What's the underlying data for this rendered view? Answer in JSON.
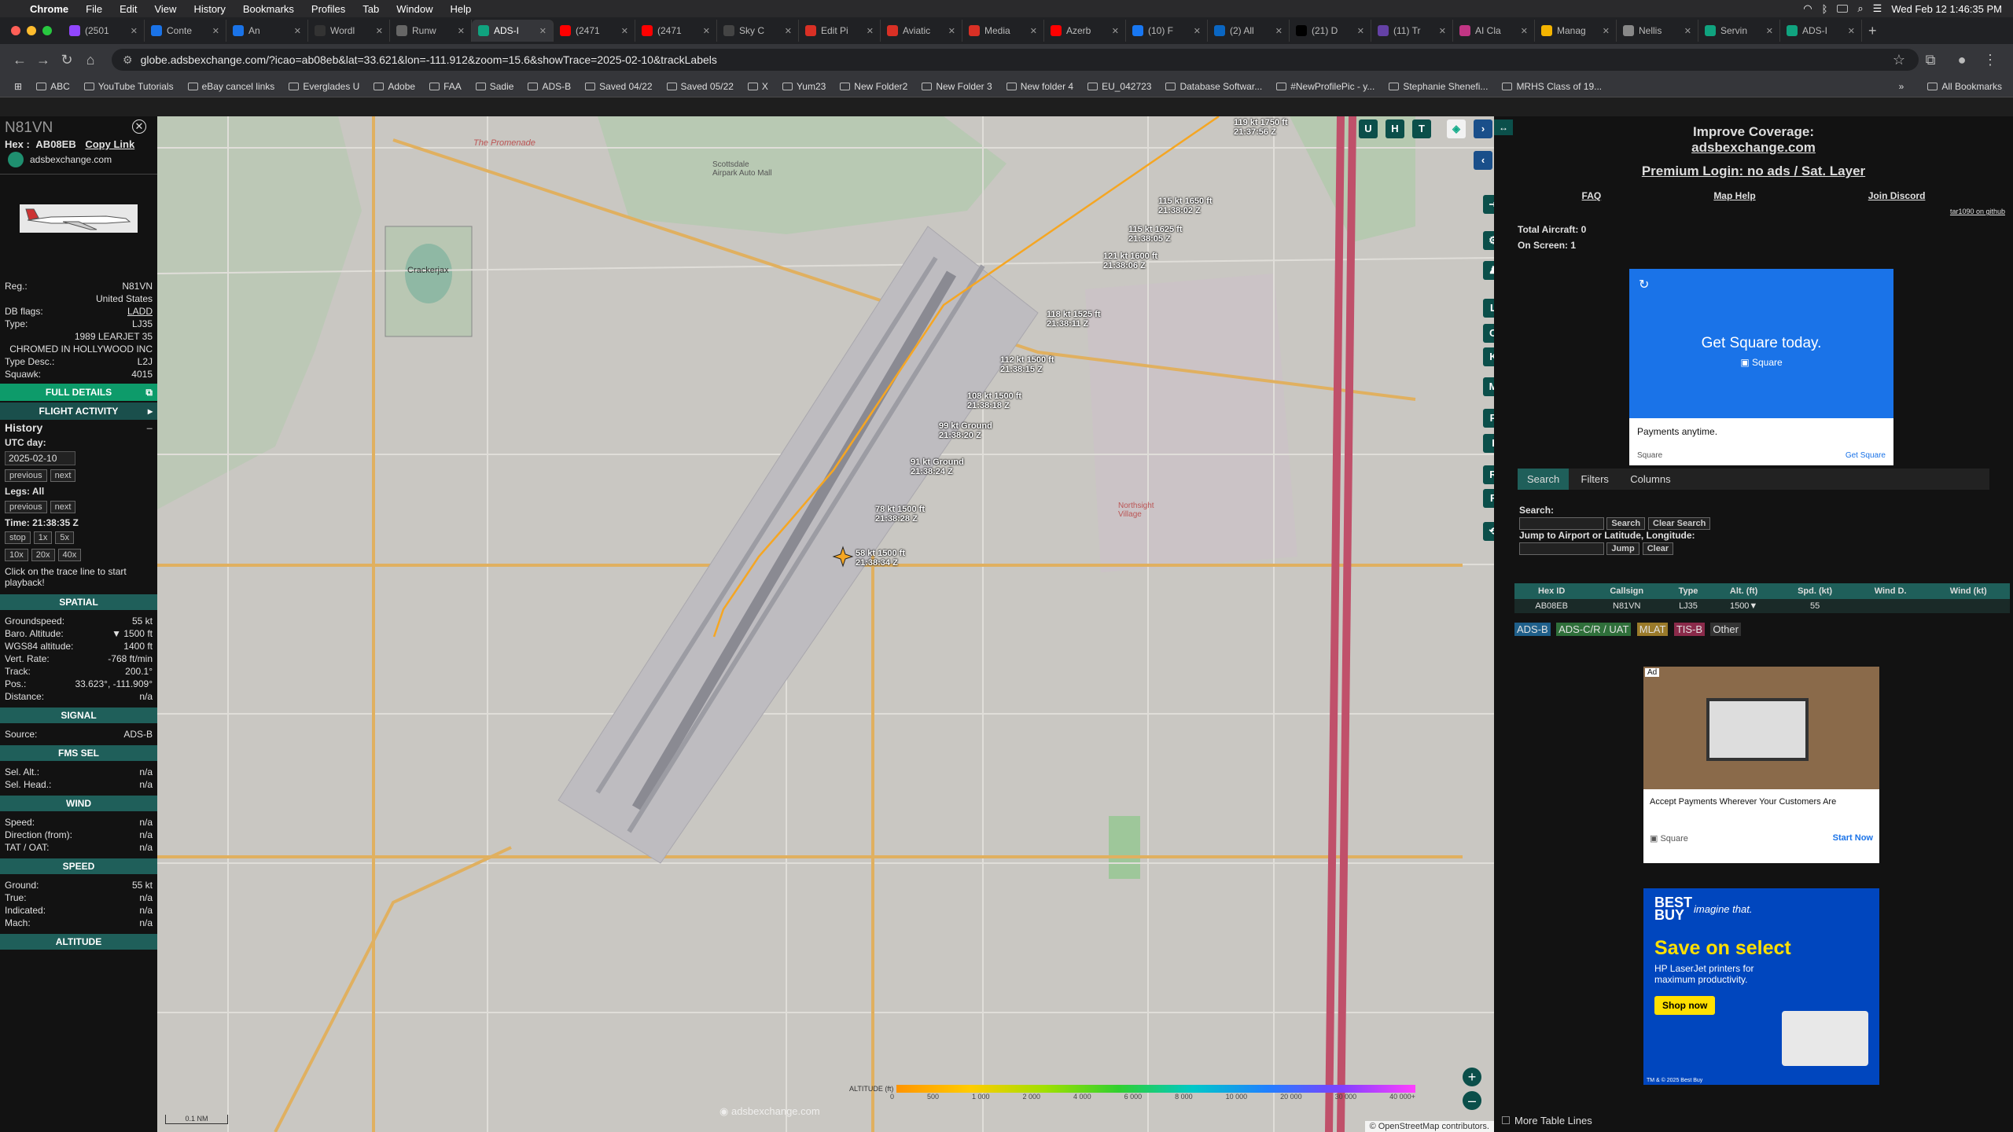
{
  "menubar": {
    "apple": "",
    "app": "Chrome",
    "items": [
      "File",
      "Edit",
      "View",
      "History",
      "Bookmarks",
      "Profiles",
      "Tab",
      "Window",
      "Help"
    ],
    "clock": "Wed Feb 12  1:46:35 PM"
  },
  "tabs": [
    {
      "label": "(2501",
      "color": "#9146ff"
    },
    {
      "label": "Conte",
      "color": "#1a73e8"
    },
    {
      "label": "An",
      "color": "#1a73e8"
    },
    {
      "label": "Wordl",
      "color": "#333"
    },
    {
      "label": "Runw",
      "color": "#666"
    },
    {
      "label": "ADS-I",
      "color": "#10a37f",
      "active": true
    },
    {
      "label": "(2471",
      "color": "#ff0000"
    },
    {
      "label": "(2471",
      "color": "#ff0000"
    },
    {
      "label": "Sky C",
      "color": "#444"
    },
    {
      "label": "Edit Pi",
      "color": "#d93025"
    },
    {
      "label": "Aviatic",
      "color": "#d93025"
    },
    {
      "label": "Media",
      "color": "#d93025"
    },
    {
      "label": "Azerb",
      "color": "#ff0000"
    },
    {
      "label": "(10) F",
      "color": "#1877f2"
    },
    {
      "label": "(2) All",
      "color": "#0a66c2"
    },
    {
      "label": "(21) D",
      "color": "#000"
    },
    {
      "label": "(11) Tr",
      "color": "#6441a5"
    },
    {
      "label": "AI Cla",
      "color": "#c13584"
    },
    {
      "label": "Manag",
      "color": "#f4b400"
    },
    {
      "label": "Nellis",
      "color": "#888"
    },
    {
      "label": "Servin",
      "color": "#10a37f"
    },
    {
      "label": "ADS-I",
      "color": "#10a37f"
    }
  ],
  "address": {
    "url": "globe.adsbexchange.com/?icao=ab08eb&lat=33.621&lon=-111.912&zoom=15.6&showTrace=2025-02-10&trackLabels"
  },
  "bookmarks": [
    "ABC",
    "YouTube Tutorials",
    "eBay cancel links",
    "Everglades U",
    "Adobe",
    "FAA",
    "Sadie",
    "ADS-B",
    "Saved 04/22",
    "Saved 05/22",
    "X",
    "Yum23",
    "New Folder2",
    "New Folder 3",
    "New folder 4",
    "EU_042723",
    "Database Softwar...",
    "#NewProfilePic - y...",
    "Stephanie Shenefi...",
    "MRHS Class of 19..."
  ],
  "bookmarks_all": "All Bookmarks",
  "aircraft": {
    "reg_title": "N81VN",
    "hex_label": "Hex :",
    "hex": "AB08EB",
    "copy_link": "Copy Link",
    "site": "adsbexchange.com",
    "reg_label": "Reg.:",
    "reg": "N81VN",
    "country": "United States",
    "dbflags_label": "DB flags:",
    "dbflags": "LADD",
    "type_label": "Type:",
    "type": "LJ35",
    "model": "1989 LEARJET 35",
    "owner": "CHROMED IN HOLLYWOOD INC",
    "typedesc_label": "Type Desc.:",
    "typedesc": "L2J",
    "squawk_label": "Squawk:",
    "squawk": "4015",
    "full_details": "FULL DETAILS",
    "flight_activity": "FLIGHT ACTIVITY"
  },
  "history": {
    "title": "History",
    "utc_label": "UTC day:",
    "utc_day": "2025-02-10",
    "prev": "previous",
    "next": "next",
    "legs": "Legs: All",
    "time": "Time: 21:38:35 Z",
    "speeds": [
      "stop",
      "1x",
      "5x"
    ],
    "speeds2": [
      "10x",
      "20x",
      "40x"
    ],
    "hint": "Click on the trace line to start playback!"
  },
  "spatial": {
    "title": "SPATIAL",
    "rows": [
      {
        "k": "Groundspeed:",
        "v": "55 kt"
      },
      {
        "k": "Baro. Altitude:",
        "v": "▼ 1500 ft"
      },
      {
        "k": "WGS84 altitude:",
        "v": "1400 ft"
      },
      {
        "k": "Vert. Rate:",
        "v": "-768 ft/min"
      },
      {
        "k": "Track:",
        "v": "200.1°"
      },
      {
        "k": "Pos.:",
        "v": "33.623°, -111.909°"
      },
      {
        "k": "Distance:",
        "v": "n/a"
      }
    ]
  },
  "signal": {
    "title": "SIGNAL",
    "rows": [
      {
        "k": "Source:",
        "v": "ADS-B"
      }
    ]
  },
  "fmssel": {
    "title": "FMS SEL",
    "rows": [
      {
        "k": "Sel. Alt.:",
        "v": "n/a"
      },
      {
        "k": "Sel. Head.:",
        "v": "n/a"
      }
    ]
  },
  "wind": {
    "title": "WIND",
    "rows": [
      {
        "k": "Speed:",
        "v": "n/a"
      },
      {
        "k": "Direction (from):",
        "v": "n/a"
      },
      {
        "k": "TAT / OAT:",
        "v": "n/a"
      }
    ]
  },
  "speed": {
    "title": "SPEED",
    "rows": [
      {
        "k": "Ground:",
        "v": "55 kt"
      },
      {
        "k": "True:",
        "v": "n/a"
      },
      {
        "k": "Indicated:",
        "v": "n/a"
      },
      {
        "k": "Mach:",
        "v": "n/a"
      }
    ]
  },
  "altitude": {
    "title": "ALTITUDE"
  },
  "map": {
    "labels": [
      {
        "t1": "119 kt  1750 ft",
        "t2": "21:37:56 Z"
      },
      {
        "t1": "115 kt  1650 ft",
        "t2": "21:38:02 Z"
      },
      {
        "t1": "115 kt  1625 ft",
        "t2": "21:38:05 Z"
      },
      {
        "t1": "121 kt  1600 ft",
        "t2": "21:38:06 Z"
      },
      {
        "t1": "118 kt  1525 ft",
        "t2": "21:38:11 Z"
      },
      {
        "t1": "112 kt  1500 ft",
        "t2": "21:38:15 Z"
      },
      {
        "t1": "108 kt  1500 ft",
        "t2": "21:38:18 Z"
      },
      {
        "t1": "99 kt  Ground",
        "t2": "21:38:20 Z"
      },
      {
        "t1": "91 kt  Ground",
        "t2": "21:38:24 Z"
      },
      {
        "t1": "78 kt  1500 ft",
        "t2": "21:38:28 Z"
      },
      {
        "t1": "58 kt  1500 ft",
        "t2": "21:38:34 Z"
      }
    ],
    "places": [
      "The Promenade",
      "Scottsdale Airpark Auto Mall",
      "Crackerjax",
      "Northsight Village"
    ],
    "buttons_top": [
      "U",
      "H",
      "T"
    ],
    "side_buttons": [
      "L",
      "O",
      "K",
      "M",
      "P",
      "I",
      "R",
      "F"
    ],
    "altitude_legend": "ALTITUDE (ft)",
    "alt_ticks": [
      "0",
      "500",
      "1 000",
      "2 000",
      "4 000",
      "6 000",
      "8 000",
      "10 000",
      "20 000",
      "30 000",
      "40 000+"
    ],
    "scale": "0.1 NM",
    "watermark": "adsbexchange.com",
    "attribution": "© OpenStreetMap contributors."
  },
  "right": {
    "improve": "Improve Coverage:",
    "site": "adsbexchange.com",
    "premium": "Premium Login: no ads / Sat. Layer",
    "links": [
      "FAQ",
      "Map Help",
      "Join Discord"
    ],
    "version": "tar1090 on github",
    "total": "Total Aircraft: 0",
    "onscreen": "On Screen: 1",
    "tabs": [
      "Search",
      "Filters",
      "Columns"
    ],
    "search_label": "Search:",
    "search_btn": "Search",
    "clear_search": "Clear Search",
    "jump_label": "Jump to Airport or Latitude, Longitude:",
    "jump_btn": "Jump",
    "clear_btn": "Clear",
    "table_headers": [
      "Hex ID",
      "Callsign",
      "Type",
      "Alt. (ft)",
      "Spd. (kt)",
      "Wind D.",
      "Wind (kt)"
    ],
    "table_rows": [
      [
        "AB08EB",
        "N81VN",
        "LJ35",
        "1500▼",
        "55",
        "",
        ""
      ]
    ],
    "sources": [
      "ADS-B",
      "ADS-C/R / UAT",
      "MLAT",
      "TIS-B",
      "Other"
    ],
    "more_lines": "More Table Lines"
  },
  "ads": {
    "square_head": "Get Square today.",
    "square_brand": "Square",
    "square_sub": "Payments anytime.",
    "square_cta": "Get Square",
    "ad_tag": "Ad",
    "square2_text": "Accept Payments Wherever Your Customers Are",
    "square2_cta": "Start Now",
    "bb_brand": "BEST BUY",
    "bb_tag": "imagine that.",
    "bb_head": "Save on select",
    "bb_sub": "HP LaserJet printers for maximum productivity.",
    "bb_cta": "Shop now",
    "bb_fine": "TM & © 2025 Best Buy"
  }
}
